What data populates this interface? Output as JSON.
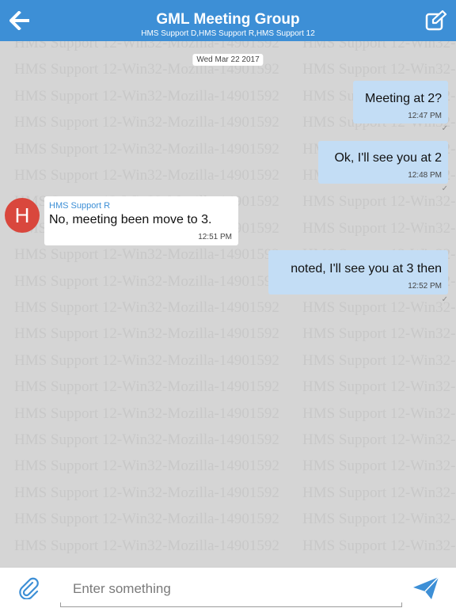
{
  "header": {
    "title": "GML Meeting Group",
    "subtitle": "HMS Support D,HMS Support R,HMS Support 12",
    "back_icon": "arrow-left-icon",
    "edit_icon": "compose-icon",
    "background_color": "#3d8fd6"
  },
  "watermark": {
    "text_left": "HMS Support 12-Win32-Mozilla-14901592",
    "text_right": "HMS Support 12-Win32-Mozilla-14901592"
  },
  "chat": {
    "date": "Wed Mar 22 2017",
    "messages": [
      {
        "direction": "out",
        "text": "Meeting at 2?",
        "time": "12:47 PM",
        "status": "✓"
      },
      {
        "direction": "out",
        "text": "Ok, I'll see you at 2",
        "time": "12:48 PM",
        "status": "✓"
      },
      {
        "direction": "in",
        "avatar_letter": "H",
        "sender": "HMS Support R",
        "text": "No, meeting been move to 3.",
        "time": "12:51 PM"
      },
      {
        "direction": "out",
        "text": "noted, I'll see you at 3 then",
        "time": "12:52 PM",
        "status": "✓"
      }
    ]
  },
  "composer": {
    "placeholder": "Enter something",
    "value": "",
    "attach_icon": "paperclip-icon",
    "send_icon": "send-icon"
  },
  "colors": {
    "accent": "#3d8fd6",
    "outgoing_bubble": "#c3ddf5",
    "incoming_bubble": "#ffffff",
    "avatar": "#d9473d",
    "chat_background": "#d5d5d5"
  }
}
